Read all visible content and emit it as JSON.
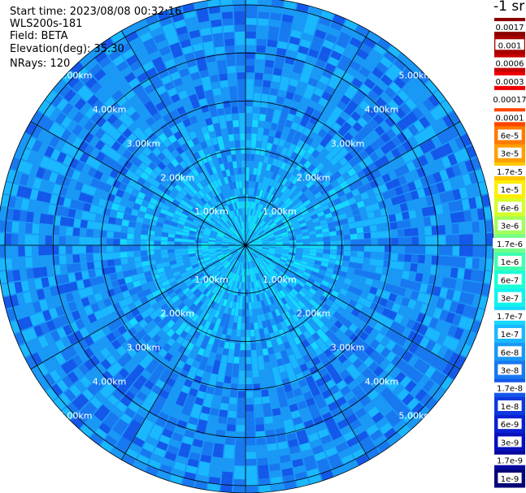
{
  "header": {
    "start_time": "Start time: 2023/08/08 00:32:16",
    "instrument": "WLS200s-181",
    "field": "Field: BETA",
    "elevation": "Elevation(deg): 35.30",
    "nrays": "NRays: 120"
  },
  "colorbar": {
    "units_label": "-1 sr",
    "entries": [
      {
        "label": "0.0017",
        "color": "#8b0000"
      },
      {
        "label": "0.001",
        "color": "#a80000"
      },
      {
        "label": "0.0006",
        "color": "#c80000"
      },
      {
        "label": "0.0003",
        "color": "#ee0000"
      },
      {
        "label": "0.00017",
        "color": "#ffffff"
      },
      {
        "label": "0.0001",
        "color": "#ff4500"
      },
      {
        "label": "6e-5",
        "color": "#ff7a00"
      },
      {
        "label": "3e-5",
        "color": "#ff9f00"
      },
      {
        "label": "1.7e-5",
        "color": "#ffc800"
      },
      {
        "label": "1e-5",
        "color": "#ffee00"
      },
      {
        "label": "6e-6",
        "color": "#d4ff2a"
      },
      {
        "label": "3e-6",
        "color": "#a0ff5a"
      },
      {
        "label": "1.7e-6",
        "color": "#70ff8a"
      },
      {
        "label": "1e-6",
        "color": "#3cffb0"
      },
      {
        "label": "6e-7",
        "color": "#1affd6"
      },
      {
        "label": "3e-7",
        "color": "#10f2ee"
      },
      {
        "label": "1.7e-7",
        "color": "#16d8ff"
      },
      {
        "label": "1e-7",
        "color": "#1ab8ff"
      },
      {
        "label": "6e-8",
        "color": "#1a98f5"
      },
      {
        "label": "3e-8",
        "color": "#1878f0"
      },
      {
        "label": "1.7e-8",
        "color": "#1458ea"
      },
      {
        "label": "1e-8",
        "color": "#0e38e0"
      },
      {
        "label": "6e-9",
        "color": "#0a20d2"
      },
      {
        "label": "3e-9",
        "color": "#0810bc"
      },
      {
        "label": "1.7e-9",
        "color": "#06089e"
      },
      {
        "label": "1e-9",
        "color": "#050578"
      }
    ]
  },
  "chart_data": {
    "type": "heatmap",
    "projection": "polar (PPI scan)",
    "nrays": 120,
    "range_rings_km": [
      1,
      2,
      3,
      4,
      5
    ],
    "ring_labels": [
      "1.00km",
      "2.00km",
      "3.00km",
      "4.00km",
      "5.00km"
    ],
    "spoke_spacing_deg": 30,
    "max_range_km": 5.1,
    "scale": "log",
    "value_range": [
      1e-09,
      0.0017
    ],
    "dominant_value_near": 1.7e-07,
    "dominant_value_far": 5e-08
  }
}
